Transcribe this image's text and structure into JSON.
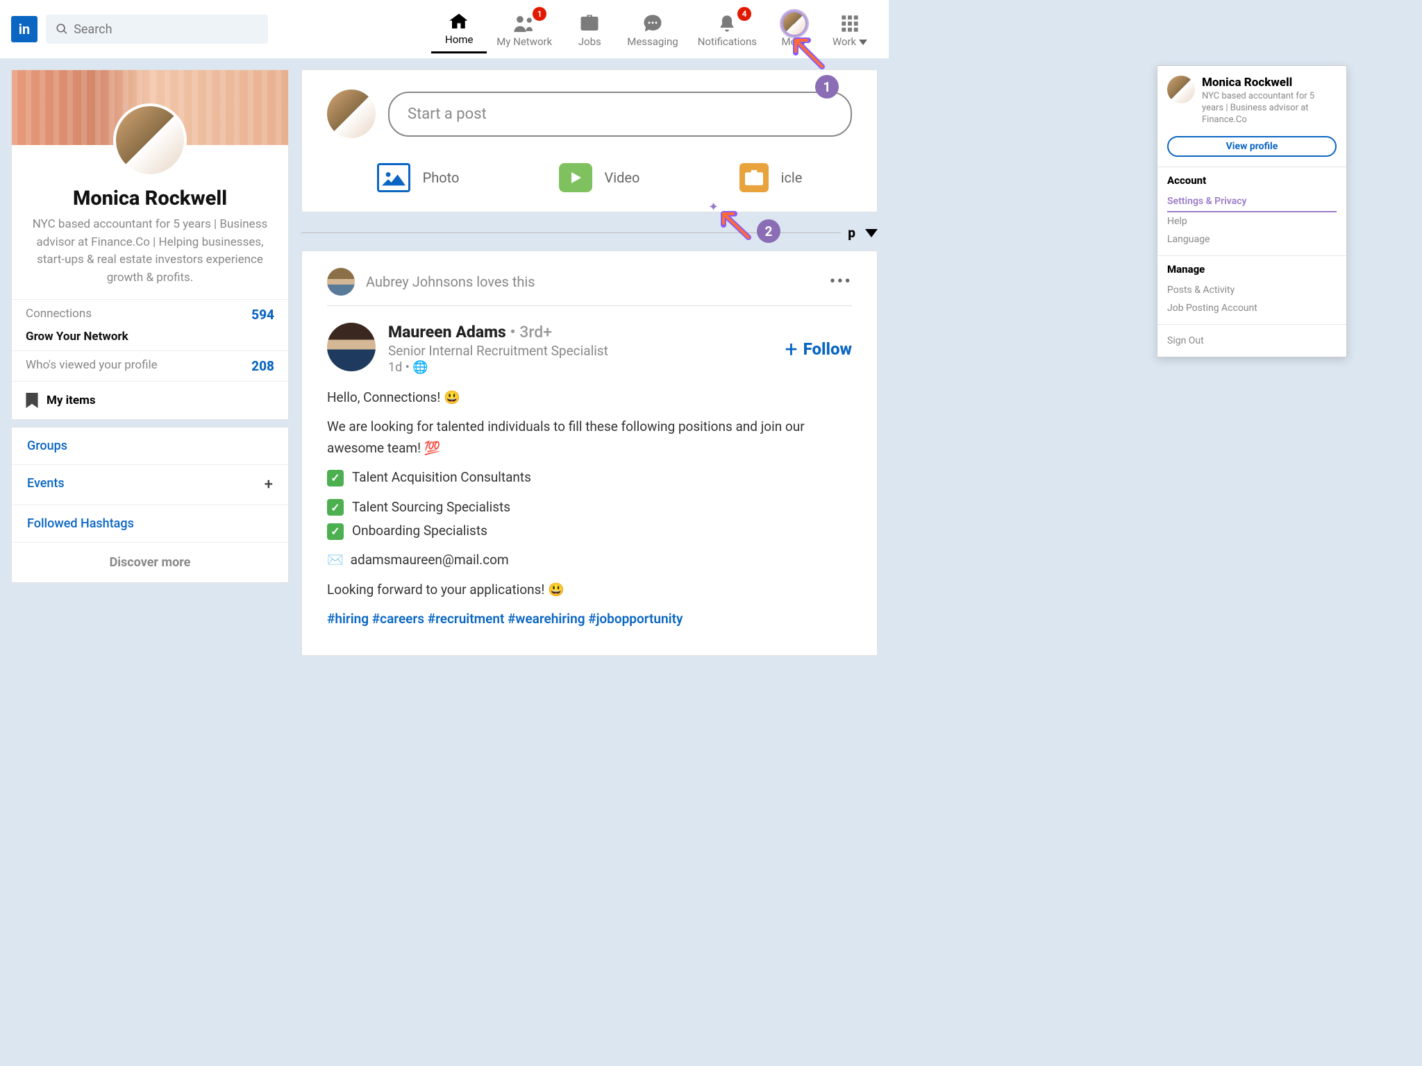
{
  "search": {
    "placeholder": "Search"
  },
  "nav": {
    "home": "Home",
    "network": "My Network",
    "jobs": "Jobs",
    "messaging": "Messaging",
    "notifications": "Notifications",
    "me": "Me",
    "work": "Work",
    "badge_network": "1",
    "badge_notif": "4"
  },
  "profile": {
    "name": "Monica Rockwell",
    "desc": "NYC based accountant for 5 years | Business advisor at Finance.Co | Helping businesses, start-ups & real estate investors experience growth & profits.",
    "connections_label": "Connections",
    "grow": "Grow Your Network",
    "connections_val": "594",
    "viewed_label": "Who's viewed your profile",
    "viewed_val": "208",
    "myitems": "My items"
  },
  "links": {
    "groups": "Groups",
    "events": "Events",
    "hashtags": "Followed Hashtags",
    "discover": "Discover more"
  },
  "post": {
    "placeholder": "Start a post",
    "photo": "Photo",
    "video": "Video",
    "article": "icle"
  },
  "sort": {
    "val": "p"
  },
  "feed": {
    "loves": "Aubrey Johnsons loves this",
    "author": "Maureen Adams",
    "degree": "• 3rd+",
    "role": "Senior Internal Recruitment Specialist",
    "time": "1d •",
    "follow": "Follow",
    "l1": "Hello, Connections! 😃",
    "l2": "We are looking for talented individuals to fill these following positions and join our awesome team! 💯",
    "c1": "Talent Acquisition Consultants",
    "c2": "Talent Sourcing Specialists",
    "c3": "Onboarding Specialists",
    "email": "adamsmaureen@mail.com",
    "l3": "Looking forward to your applications! 😃",
    "tags": "#hiring #careers #recruitment #wearehiring #jobopportunity"
  },
  "dropdown": {
    "name": "Monica Rockwell",
    "desc": "NYC based accountant for 5 years | Business advisor at Finance.Co",
    "view": "View profile",
    "account": "Account",
    "settings": "Settings & Privacy",
    "help": "Help",
    "language": "Language",
    "manage": "Manage",
    "posts": "Posts & Activity",
    "jobposting": "Job Posting Account",
    "signout": "Sign Out"
  },
  "annot": {
    "n1": "1",
    "n2": "2"
  }
}
